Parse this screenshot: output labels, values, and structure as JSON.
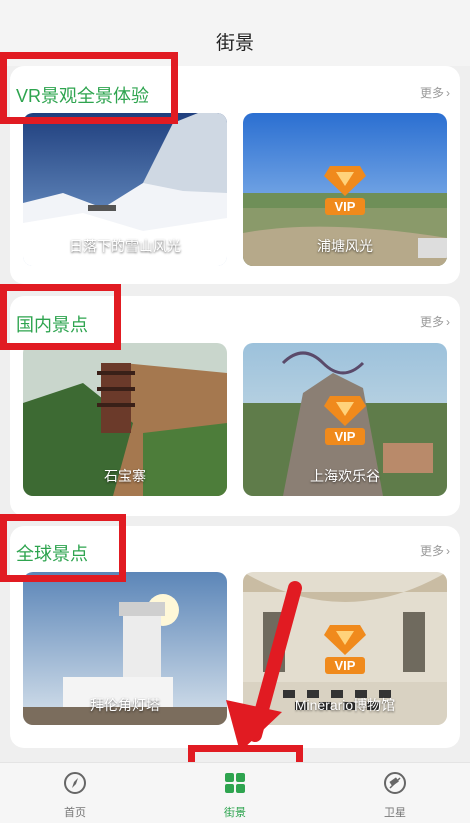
{
  "header": {
    "title": "街景"
  },
  "sections": [
    {
      "title": "VR景观全景体验",
      "more": "更多",
      "tiles": [
        {
          "caption": "日落下的雪山风光",
          "vip": false
        },
        {
          "caption": "浦塘风光",
          "vip": true
        }
      ]
    },
    {
      "title": "国内景点",
      "more": "更多",
      "tiles": [
        {
          "caption": "石宝寨",
          "vip": false
        },
        {
          "caption": "上海欢乐谷",
          "vip": true
        }
      ]
    },
    {
      "title": "全球景点",
      "more": "更多",
      "tiles": [
        {
          "caption": "拜伦角灯塔",
          "vip": false
        },
        {
          "caption": "Minerario博物馆",
          "vip": true
        }
      ]
    }
  ],
  "vip_badge": "VIP",
  "tabbar": {
    "items": [
      {
        "label": "首页",
        "icon": "compass-icon",
        "active": false
      },
      {
        "label": "街景",
        "icon": "grid-icon",
        "active": true
      },
      {
        "label": "卫星",
        "icon": "satellite-icon",
        "active": false
      }
    ]
  },
  "colors": {
    "accent": "#2ea44f",
    "highlight": "#e11b22",
    "vip": "#f08a1c"
  }
}
